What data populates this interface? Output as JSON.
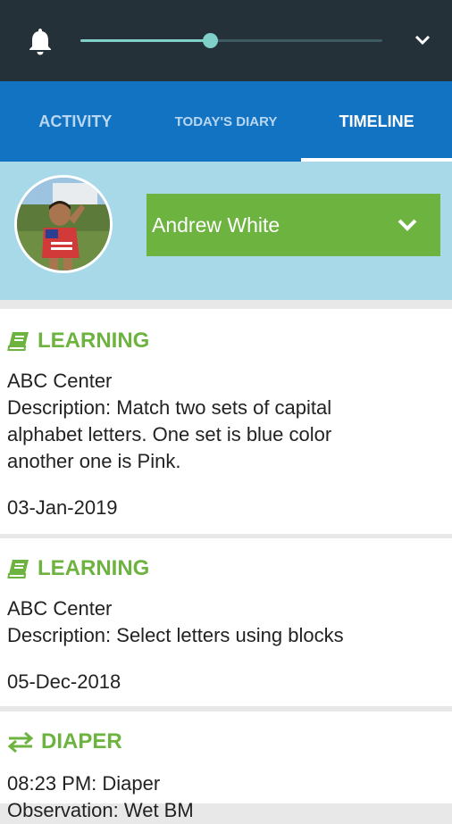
{
  "header": {
    "slider_value_fraction": 0.43,
    "icons": [
      "bell-icon",
      "chevron-down-icon"
    ],
    "colors": {
      "bar": "#243139",
      "slider": "#7fd0c8"
    }
  },
  "tabs": [
    {
      "label": "ACTIVITY",
      "active": false
    },
    {
      "label": "TODAY'S DIARY",
      "active": false
    },
    {
      "label": "TIMELINE",
      "active": true
    }
  ],
  "profile": {
    "child_name": "Andrew White",
    "colors": {
      "panel": "#a8d9e8",
      "select": "#6db33f"
    }
  },
  "timeline": [
    {
      "category": "LEARNING",
      "icon": "book-icon",
      "lines": [
        "ABC Center",
        "Description: Match two sets of capital alphabet letters. One set is blue color another one is Pink."
      ],
      "date": "03-Jan-2019"
    },
    {
      "category": "LEARNING",
      "icon": "book-icon",
      "lines": [
        "ABC Center",
        "Description: Select letters using blocks"
      ],
      "date": "05-Dec-2018"
    },
    {
      "category": "DIAPER",
      "icon": "swap-arrows-icon",
      "lines": [
        "08:23 PM: Diaper",
        "Observation: Wet BM"
      ],
      "date": ""
    }
  ]
}
